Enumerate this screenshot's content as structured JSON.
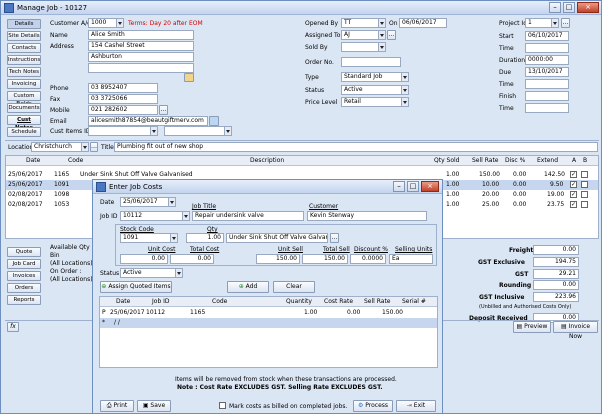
{
  "window": {
    "title": "Manage Job - 10127"
  },
  "left_nav": {
    "items": [
      "Details",
      "Site Details",
      "Contacts",
      "Instructions",
      "Tech Notes",
      "Invoicing",
      "Custom Fields",
      "Documents",
      "Cust Notes",
      "Schedule"
    ],
    "bottom_items": [
      "Quote",
      "Job Card",
      "Invoices",
      "Orders",
      "Reports"
    ]
  },
  "customer": {
    "account_label": "Customer A/c",
    "account_value": "1000",
    "terms": "Terms: Day 20 after EOM",
    "name_label": "Name",
    "name_value": "Alice Smith",
    "address_label": "Address",
    "address_line1": "154 Cashel Street",
    "address_line2": "Ashburton",
    "phone_label": "Phone",
    "phone_value": "03 8952407",
    "fax_label": "Fax",
    "fax_value": "03 3725066",
    "mobile_label": "Mobile",
    "mobile_value": "021 282602",
    "email_label": "Email",
    "email_value": "alicesmith87854@beautgiftmerv.com",
    "cust_items_label": "Cust Items ID"
  },
  "job": {
    "opened_by_label": "Opened By",
    "opened_by_value": "TT",
    "on_label": "On",
    "on_value": "06/06/2017",
    "assigned_label": "Assigned To",
    "assigned_value": "AJ",
    "sold_by_label": "Sold By",
    "order_no_label": "Order No.",
    "type_label": "Type",
    "type_value": "Standard Job",
    "status_label": "Status",
    "status_value": "Active",
    "price_level_label": "Price Level",
    "price_level_value": "Retail"
  },
  "project": {
    "project_id_label": "Project Id",
    "project_id_value": "1",
    "start_label": "Start",
    "start_value": "06/10/2017",
    "time1_label": "Time",
    "duration_label": "Duration",
    "duration_value": "0000:00",
    "due_label": "Due",
    "due_value": "13/10/2017",
    "time2_label": "Time",
    "finish_label": "Finish",
    "time3_label": "Time"
  },
  "location": {
    "label": "Location",
    "value": "Christchurch",
    "title_label": "Title",
    "title_value": "Plumbing fit out of new shop"
  },
  "costs_table": {
    "columns": [
      "Date",
      "Code",
      "Description",
      "Qty Sold",
      "Sell Rate",
      "Disc %",
      "Extend",
      "A",
      "B"
    ],
    "rows": [
      {
        "date": "25/06/2017",
        "code": "1165",
        "desc": "Under Sink Shut Off Valve Galvanised",
        "qty": "1.00",
        "rate": "150.00",
        "disc": "0.00",
        "extend": "142.50",
        "a": true,
        "b": false
      },
      {
        "date": "25/06/2017",
        "code": "1091",
        "desc": "",
        "qty": "1.00",
        "rate": "10.00",
        "disc": "0.00",
        "extend": "9.50",
        "a": true,
        "b": false
      },
      {
        "date": "02/08/2017",
        "code": "1098",
        "desc": "",
        "qty": "1.00",
        "rate": "20.00",
        "disc": "0.00",
        "extend": "19.00",
        "a": true,
        "b": false
      },
      {
        "date": "02/08/2017",
        "code": "1053",
        "desc": "",
        "qty": "1.00",
        "rate": "25.00",
        "disc": "0.00",
        "extend": "23.75",
        "a": true,
        "b": false
      }
    ]
  },
  "available_qty": {
    "title": "Available Qty",
    "bin": "Bin",
    "all1": "(All Locations) :",
    "on_order": "On Order :",
    "all2": "(All Locations) :"
  },
  "totals": {
    "freight_label": "Freight",
    "freight_value": "0.00",
    "gst_excl_label": "GST Exclusive",
    "gst_excl_value": "194.75",
    "gst_label": "GST",
    "gst_value": "29.21",
    "rounding_label": "Rounding",
    "rounding_value": "0.00",
    "gst_incl_label": "GST Inclusive",
    "gst_incl_value": "223.96",
    "note": "(Unbilled and Authorised Costs Only)",
    "deposit_label": "Deposit Received",
    "deposit_value": "0.00"
  },
  "footer": {
    "preview": "Preview",
    "invoice_now": "Invoice Now",
    "fx": "fx"
  },
  "dialog": {
    "title": "Enter Job Costs",
    "date_label": "Date",
    "date_value": "25/06/2017",
    "job_title_label": "Job Title",
    "customer_label": "Customer",
    "job_id_label": "Job ID",
    "job_id_value": "10112",
    "job_title_value": "Repair undersink valve",
    "customer_value": "Kevin Stenway",
    "stock_code_label": "Stock Code",
    "qty_label": "Qty",
    "stock_code_value": "1091",
    "qty_value": "1.00",
    "stock_desc": "Under Sink Shut Off Valve Galvanised",
    "unit_cost_label": "Unit Cost",
    "total_cost_label": "Total Cost",
    "unit_sell_label": "Unit Sell",
    "total_sell_label": "Total Sell",
    "discount_label": "Discount %",
    "selling_units_label": "Selling Units",
    "unit_cost_value": "0.00",
    "total_cost_value": "0.00",
    "unit_sell_value": "150.00",
    "total_sell_value": "150.00",
    "discount_value": "0.0000",
    "selling_units_value": "Ea",
    "status_label": "Status",
    "status_value": "Active",
    "assign_quoted": "Assign Quoted Items",
    "add": "Add",
    "clear": "Clear",
    "grid_columns": [
      "Date",
      "Job ID",
      "Code",
      "Quantity",
      "Cost Rate",
      "Sell Rate",
      "Serial #"
    ],
    "grid_row": {
      "flag": "P",
      "date": "25/06/2017",
      "job_id": "10112",
      "code": "1165",
      "qty": "1.00",
      "cost": "0.00",
      "sell": "150.00"
    },
    "grid_row2": {
      "flag": "*",
      "date": "/ /"
    },
    "info_line1": "Items will be removed from stock when these transactions are processed.",
    "info_line2": "Note : Cost Rate EXCLUDES GST.  Selling Rate EXCLUDES GST.",
    "print": "Print",
    "save": "Save",
    "mark_billed": "Mark costs as billed on completed jobs.",
    "process": "Process",
    "exit": "Exit"
  }
}
